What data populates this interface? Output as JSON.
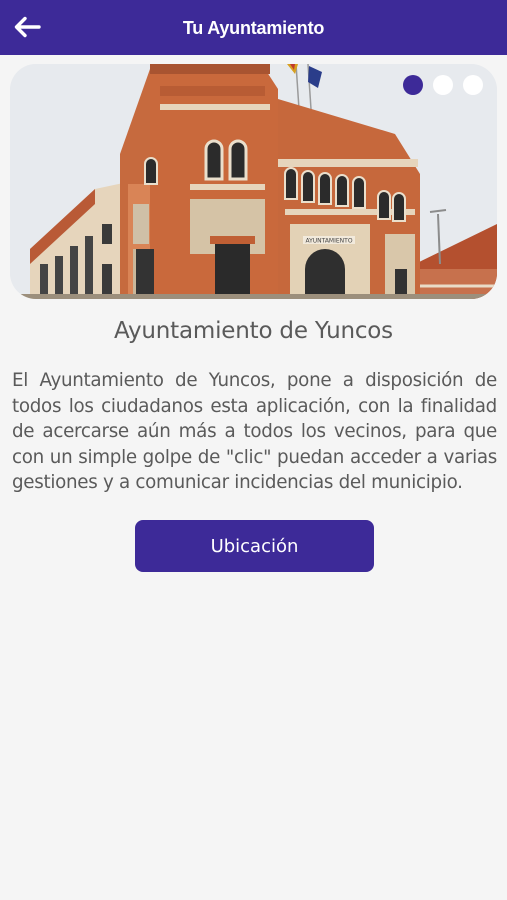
{
  "header": {
    "title": "Tu Ayuntamiento",
    "back_icon": "arrow-left-icon"
  },
  "carousel": {
    "slide_count": 3,
    "active_index": 0,
    "building_sign": "AYUNTAMIENTO"
  },
  "content": {
    "heading": "Ayuntamiento de Yuncos",
    "description": "El Ayuntamiento de Yuncos, pone a disposición de todos los ciudadanos esta aplicación, con la finalidad de acercarse aún más a todos los vecinos, para que con un simple golpe de \"clic\" puedan acceder a varias gestiones y a comunicar incidencias del municipio.",
    "location_button": "Ubicación"
  },
  "colors": {
    "primary": "#3d2a98",
    "background": "#f5f5f5",
    "text": "#5a5a5a"
  }
}
